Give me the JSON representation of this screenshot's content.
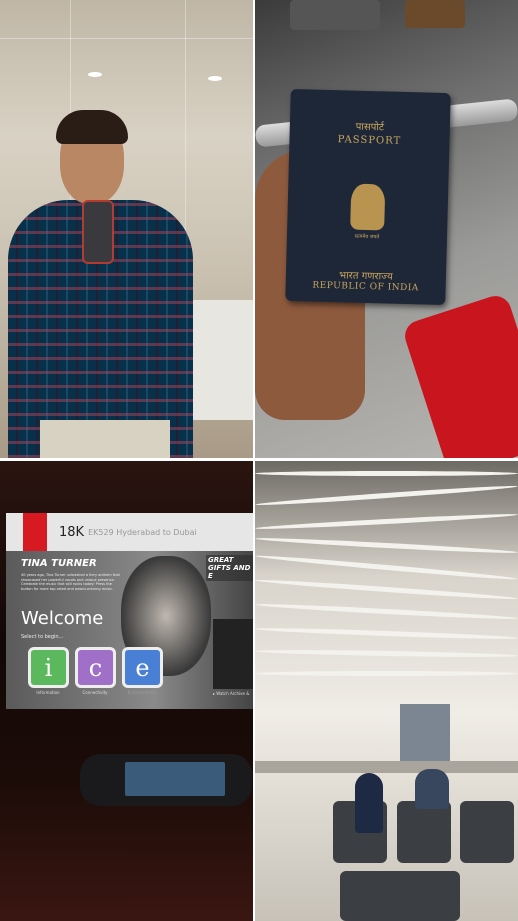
{
  "collage": {
    "selfie": {
      "description_icon": "mirror-selfie-photo"
    },
    "passport": {
      "title_hindi": "पासपोर्ट",
      "title": "PASSPORT",
      "motto": "सत्यमेव जयते",
      "country_hindi": "भारत गणराज्य",
      "country": "REPUBLIC OF INDIA",
      "cover_color": "#1e2738",
      "text_color": "#c9a660"
    },
    "inflight_screen": {
      "airline_logo": "Emirates",
      "seat": "18K",
      "flight": "EK529 Hyderabad to Dubai",
      "promo_title": "TINA TURNER",
      "promo_text": "40 years ago, Tina Turner unleashed a fiery anthem that showcased her powerful vocals and unique presence. Celebrate the music that still rocks today! Press the button for more top-rated and award-winning music.",
      "welcome": "Welcome",
      "select_prompt": "Select to begin...",
      "tiles": [
        {
          "letter": "i",
          "label": "Information",
          "color": "#5cb85c"
        },
        {
          "letter": "c",
          "label": "Connectivity",
          "color": "#a070c8"
        },
        {
          "letter": "e",
          "label": "Entertainment",
          "color": "#4a7fd6"
        }
      ],
      "side_title": "GREAT GIFTS AND E",
      "side_link": "▸ Watch Archive &",
      "brand_color": "#d71921"
    },
    "airport": {
      "description_icon": "airport-terminal-photo"
    }
  }
}
